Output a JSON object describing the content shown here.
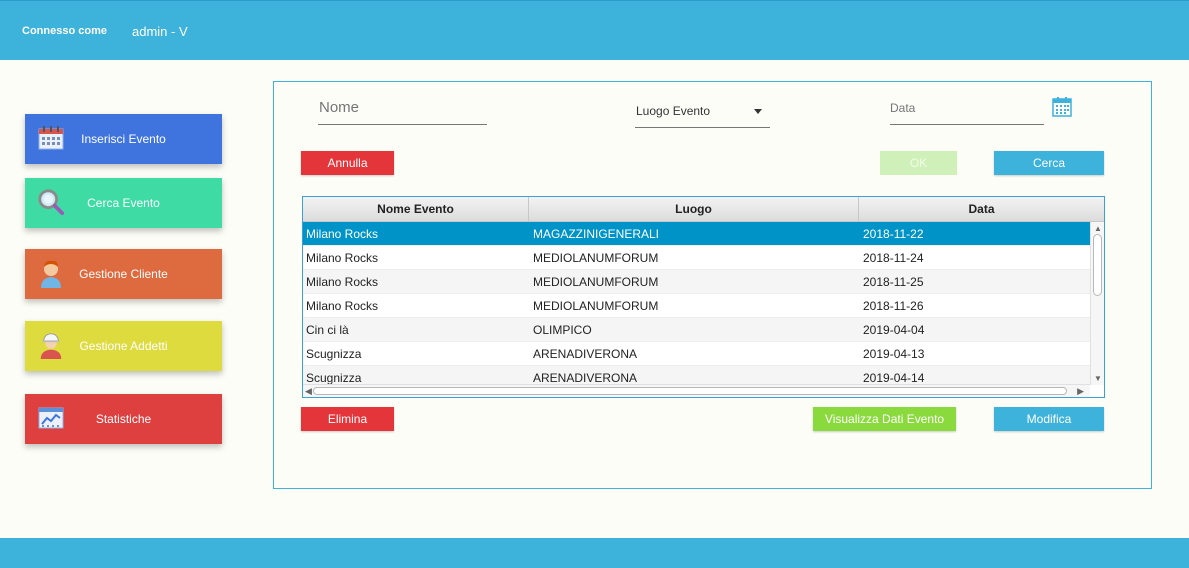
{
  "header": {
    "label": "Connesso come",
    "user": "admin - V"
  },
  "nav": {
    "inserisci": "Inserisci Evento",
    "cerca": "Cerca Evento",
    "cliente": "Gestione Cliente",
    "addetti": "Gestione Addetti",
    "statistiche": "Statistiche"
  },
  "search": {
    "nome_placeholder": "Nome",
    "luogo_label": "Luogo Evento",
    "data_placeholder": "Data"
  },
  "buttons": {
    "annulla": "Annulla",
    "ok": "OK",
    "cerca": "Cerca",
    "elimina": "Elimina",
    "visualizza": "Visualizza Dati Evento",
    "modifica": "Modifica"
  },
  "table": {
    "headers": [
      "Nome Evento",
      "Luogo",
      "Data"
    ],
    "rows": [
      [
        "Milano Rocks",
        "MAGAZZINIGENERALI",
        "2018-11-22"
      ],
      [
        "Milano Rocks",
        "MEDIOLANUMFORUM",
        "2018-11-24"
      ],
      [
        "Milano Rocks",
        "MEDIOLANUMFORUM",
        "2018-11-25"
      ],
      [
        "Milano Rocks",
        "MEDIOLANUMFORUM",
        "2018-11-26"
      ],
      [
        "Cin ci là",
        "OLIMPICO",
        "2019-04-04"
      ],
      [
        "Scugnizza",
        "ARENADIVERONA",
        "2019-04-13"
      ],
      [
        "Scugnizza",
        "ARENADIVERONA",
        "2019-04-14"
      ]
    ]
  },
  "colors": {
    "accent": "#3db2db",
    "inserisci": "#3f74de",
    "cerca": "#3fdba5",
    "cliente": "#de6a3f",
    "addetti": "#dedb3f",
    "statistiche": "#de3f3f",
    "danger": "#e4353a",
    "success": "#8ad93d",
    "selected_row": "#0093c8"
  },
  "icons": {
    "inserisci": "calendar-icon",
    "cerca": "magnifier-icon",
    "cliente": "person-icon",
    "addetti": "worker-icon",
    "statistiche": "chart-icon",
    "data": "calendar-icon"
  }
}
